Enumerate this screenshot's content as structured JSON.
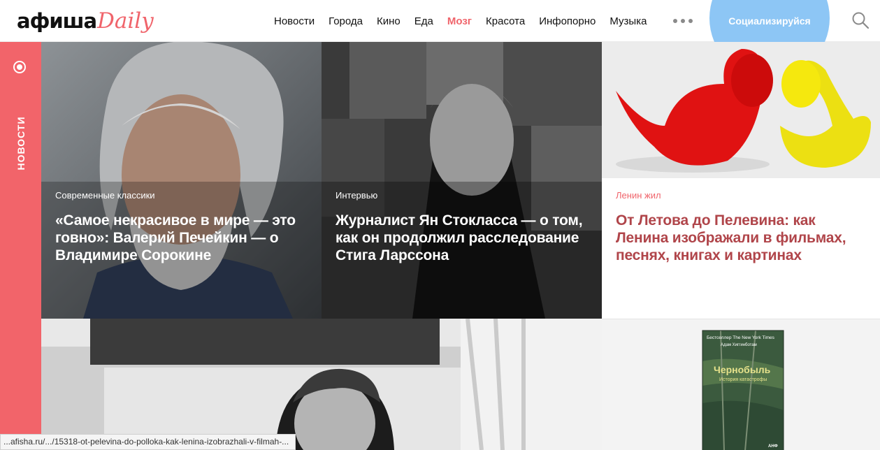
{
  "header": {
    "logo_main": "афиша",
    "logo_accent": "Daily",
    "nav": [
      "Новости",
      "Города",
      "Кино",
      "Еда",
      "Мозг",
      "Красота",
      "Инфопорно",
      "Музыка"
    ],
    "active_nav": "Мозг",
    "social_button": "Социализируйся",
    "accent_color": "#f0646b"
  },
  "rail": {
    "label": "НОВОСТИ"
  },
  "cards": [
    {
      "rubric": "Современные классики",
      "title": "«Самое некрасивое в мире — это говно»: Валерий Печейкин — о Владимире Сорокине"
    },
    {
      "rubric": "Интервью",
      "title": "Журналист Ян Стокласса — о том, как он продолжил расследование Стига Ларссона"
    },
    {
      "rubric": "Ленин жил",
      "title": "От Летова до Пелевина: как Ленина изображали в фильмах, песнях, книгах и картинах"
    }
  ],
  "book": {
    "top_line": "Бестселлер The New York Times",
    "author": "Адам Хиггинботам",
    "title": "Чернобыль",
    "subtitle": "История катастрофы",
    "publisher": "АНФ"
  },
  "status_bar": {
    "url": "...afisha.ru/.../15318-ot-pelevina-do-polloka-kak-lenina-izobrazhali-v-filmah-..."
  }
}
